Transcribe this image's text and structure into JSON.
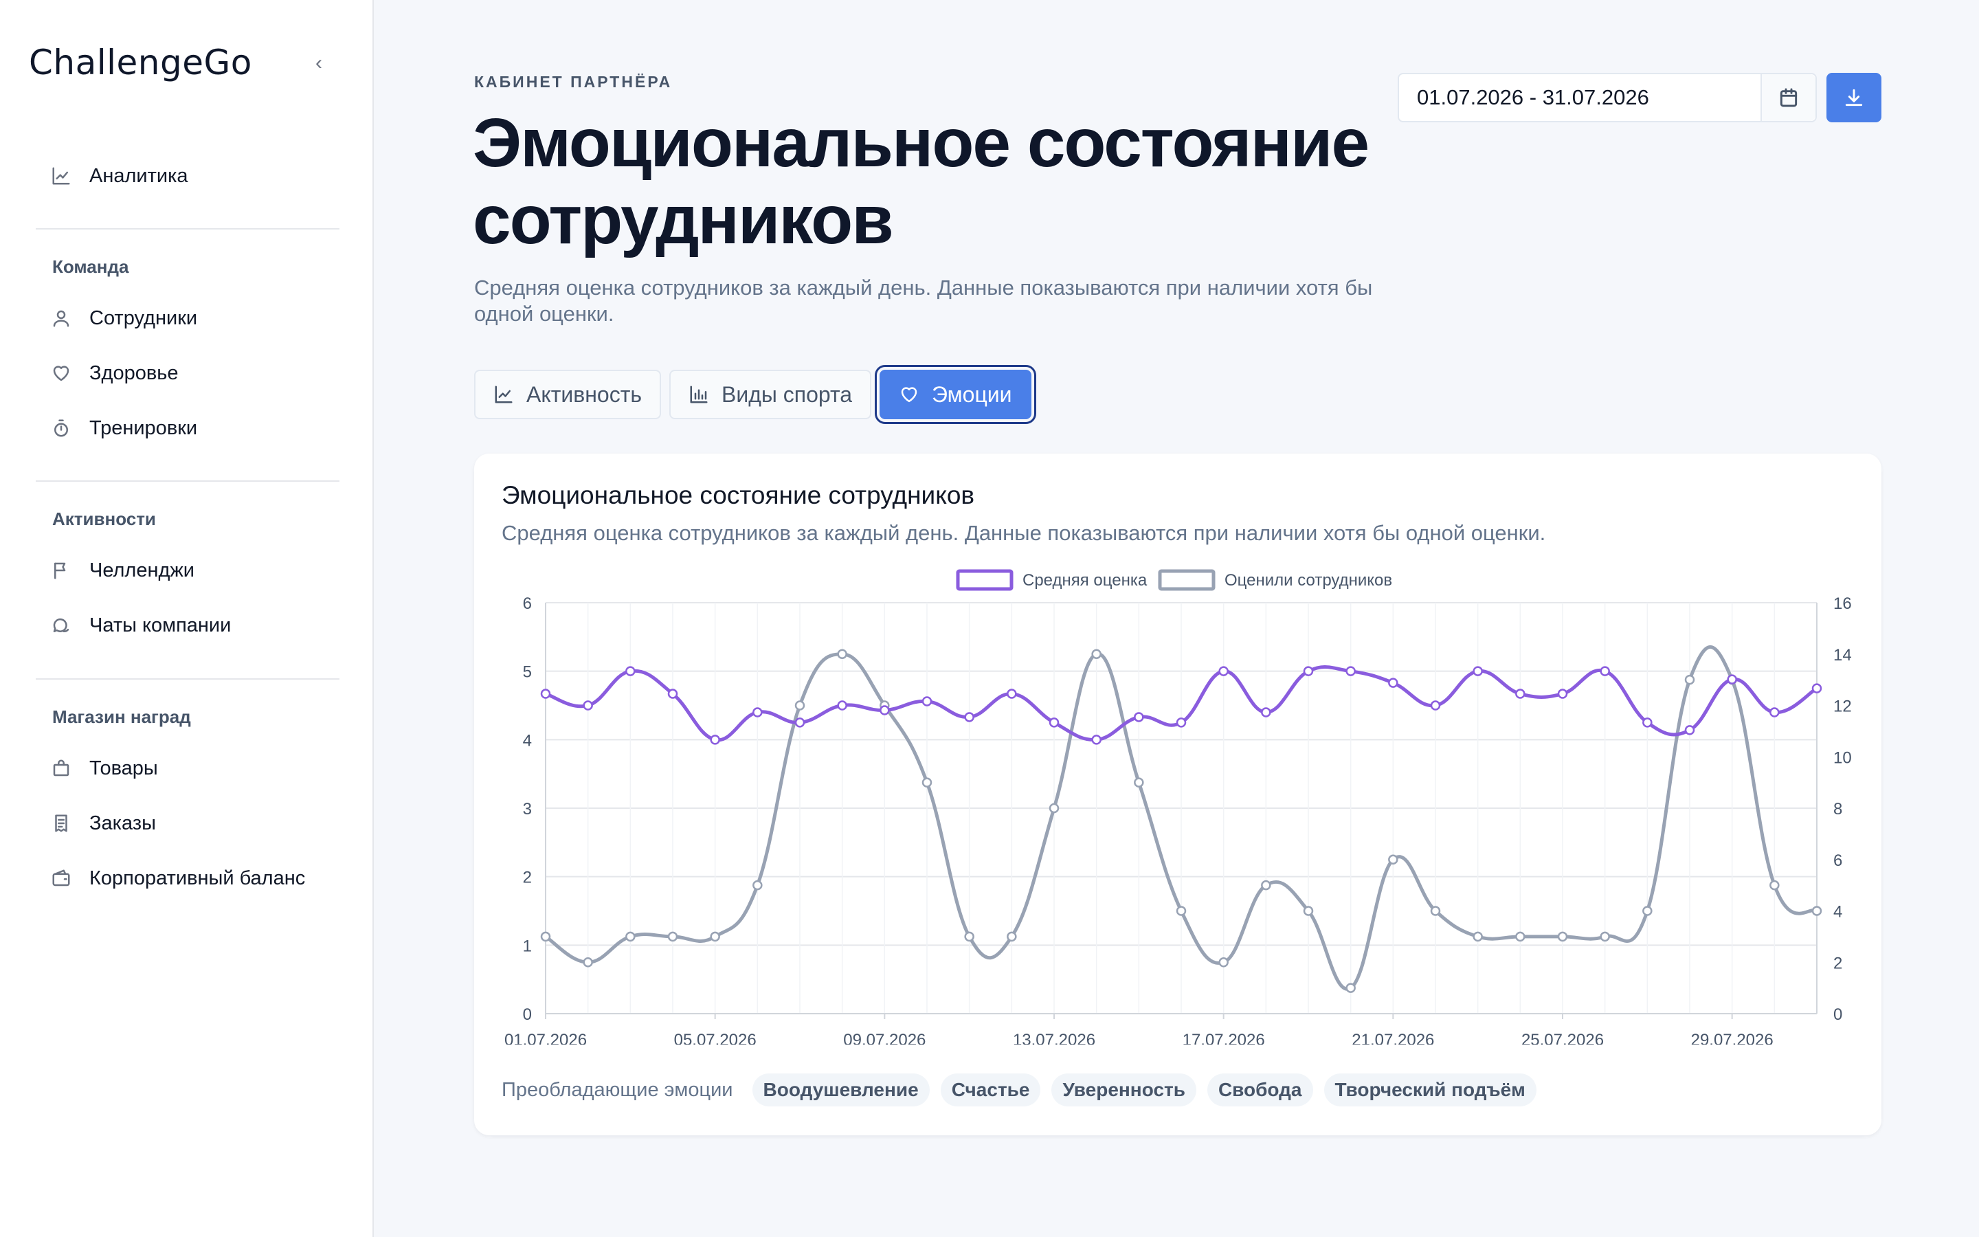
{
  "sidebar": {
    "brand": "ChallengeGo",
    "collapse_icon": "‹",
    "items": {
      "analytics": "Аналитика",
      "employees": "Сотрудники",
      "health": "Здоровье",
      "trainings": "Тренировки",
      "challenges": "Челленджи",
      "chats": "Чаты компании",
      "products": "Товары",
      "orders": "Заказы",
      "balance": "Корпоративный баланс"
    },
    "sections": {
      "team": "Команда",
      "activity": "Активности",
      "shop": "Магазин наград"
    }
  },
  "header": {
    "eyebrow": "КАБИНЕТ ПАРТНЁРА",
    "title": "Эмоциональное состояние сотрудников",
    "description": "Средняя оценка сотрудников за каждый день. Данные показываются при наличии хотя бы одной оценки.",
    "date_range": "01.07.2026 - 31.07.2026"
  },
  "tabs": {
    "activity": "Активность",
    "sports": "Виды спорта",
    "emotions": "Эмоции"
  },
  "card": {
    "title": "Эмоциональное состояние сотрудников",
    "description": "Средняя оценка сотрудников за каждый день. Данные показываются при наличии хотя бы одной оценки.",
    "emotions_label": "Преобладающие эмоции",
    "emotions": [
      "Воодушевление",
      "Счастье",
      "Уверенность",
      "Свобода",
      "Творческий подъём"
    ]
  },
  "chart_data": {
    "type": "line",
    "legend_position": "top-center",
    "grid": true,
    "x": [
      "01.07.2026",
      "02.07.2026",
      "03.07.2026",
      "04.07.2026",
      "05.07.2026",
      "06.07.2026",
      "07.07.2026",
      "08.07.2026",
      "09.07.2026",
      "10.07.2026",
      "11.07.2026",
      "12.07.2026",
      "13.07.2026",
      "14.07.2026",
      "15.07.2026",
      "16.07.2026",
      "17.07.2026",
      "18.07.2026",
      "19.07.2026",
      "20.07.2026",
      "21.07.2026",
      "22.07.2026",
      "23.07.2026",
      "24.07.2026",
      "25.07.2026",
      "26.07.2026",
      "27.07.2026",
      "28.07.2026",
      "29.07.2026",
      "30.07.2026",
      "31.07.2026"
    ],
    "x_tick_labels": [
      "01.07.2026",
      "05.07.2026",
      "09.07.2026",
      "13.07.2026",
      "17.07.2026",
      "21.07.2026",
      "25.07.2026",
      "29.07.2026"
    ],
    "y_left": {
      "min": 0,
      "max": 6,
      "ticks": [
        "0",
        "1",
        "2",
        "3",
        "4",
        "5",
        "6"
      ]
    },
    "y_right": {
      "min": 0,
      "max": 16,
      "ticks": [
        "0",
        "2",
        "4",
        "6",
        "8",
        "10",
        "12",
        "14",
        "16"
      ]
    },
    "series": [
      {
        "name": "Средняя оценка",
        "axis": "left",
        "color": "#8a5cde",
        "values": [
          4.67,
          4.5,
          5.0,
          4.67,
          4.0,
          4.4,
          4.25,
          4.5,
          4.43,
          4.56,
          4.33,
          4.67,
          4.25,
          4.0,
          4.33,
          4.25,
          5.0,
          4.4,
          5.0,
          5.0,
          4.83,
          4.5,
          5.0,
          4.67,
          4.67,
          5.0,
          4.25,
          4.14,
          4.88,
          4.4,
          4.75
        ]
      },
      {
        "name": "Оценили сотрудников",
        "axis": "right",
        "color": "#98a2b3",
        "values": [
          3,
          2,
          3,
          3,
          3,
          5,
          12,
          14,
          12,
          9,
          3,
          3,
          8,
          14,
          9,
          4,
          2,
          5,
          4,
          1,
          6,
          4,
          3,
          3,
          3,
          3,
          4,
          13,
          13,
          5,
          4
        ]
      }
    ]
  }
}
